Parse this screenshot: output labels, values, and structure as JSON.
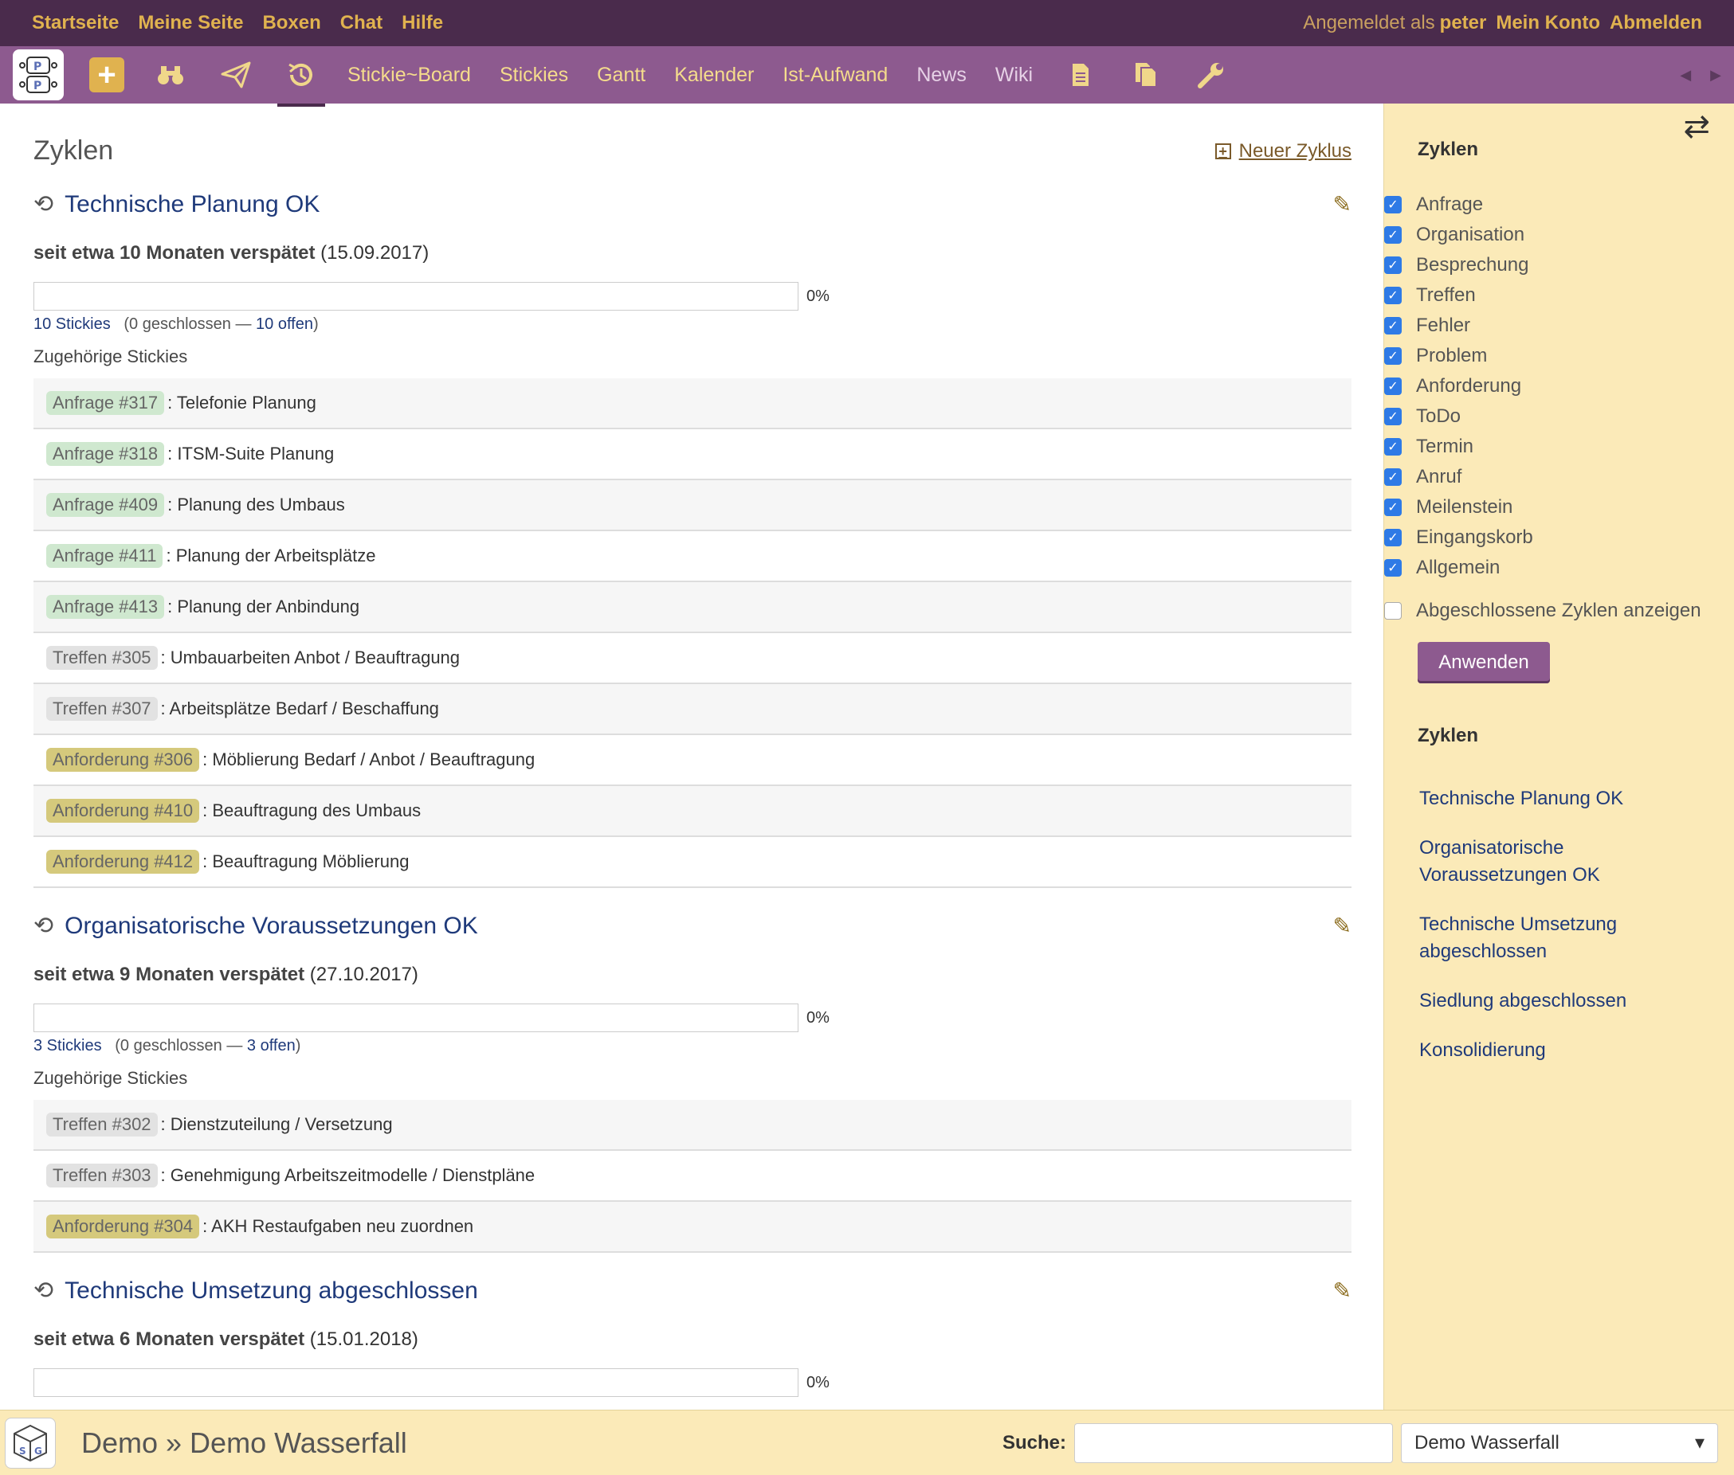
{
  "topbar": {
    "left": [
      "Startseite",
      "Meine Seite",
      "Boxen",
      "Chat",
      "Hilfe"
    ],
    "logged_in_as": "Angemeldet als",
    "user": "peter",
    "my_account": "Mein Konto",
    "logout": "Abmelden"
  },
  "nav": {
    "links": [
      "Stickie~Board",
      "Stickies",
      "Gantt",
      "Kalender",
      "Ist-Aufwand",
      "News",
      "Wiki"
    ]
  },
  "main": {
    "title": "Zyklen",
    "new_cycle": "Neuer Zyklus",
    "cycles": [
      {
        "title": "Technische Planung OK",
        "late": "seit etwa 10 Monaten verspätet",
        "date": "(15.09.2017)",
        "progress": 0,
        "progress_label": "0%",
        "stickies": "10 Stickies",
        "counts_open_paren": "(0 geschlossen —",
        "open": "10 offen",
        "close_paren": ")",
        "related": "Zugehörige Stickies",
        "issues": [
          {
            "tag": "Anfrage #317",
            "type": "anfrage",
            "text": ": Telefonie Planung"
          },
          {
            "tag": "Anfrage #318",
            "type": "anfrage",
            "text": ": ITSM-Suite Planung"
          },
          {
            "tag": "Anfrage #409",
            "type": "anfrage",
            "text": ": Planung des Umbaus"
          },
          {
            "tag": "Anfrage #411",
            "type": "anfrage",
            "text": ": Planung der Arbeitsplätze"
          },
          {
            "tag": "Anfrage #413",
            "type": "anfrage",
            "text": ": Planung der Anbindung"
          },
          {
            "tag": "Treffen #305",
            "type": "treffen",
            "text": ": Umbauarbeiten Anbot / Beauftragung"
          },
          {
            "tag": "Treffen #307",
            "type": "treffen",
            "text": ": Arbeitsplätze Bedarf / Beschaffung"
          },
          {
            "tag": "Anforderung #306",
            "type": "anforderung",
            "text": ": Möblierung Bedarf / Anbot / Beauftragung"
          },
          {
            "tag": "Anforderung #410",
            "type": "anforderung",
            "text": ": Beauftragung des Umbaus"
          },
          {
            "tag": "Anforderung #412",
            "type": "anforderung",
            "text": ": Beauftragung Möblierung"
          }
        ]
      },
      {
        "title": "Organisatorische Voraussetzungen OK",
        "late": "seit etwa 9 Monaten verspätet",
        "date": "(27.10.2017)",
        "progress": 0,
        "progress_label": "0%",
        "stickies": "3 Stickies",
        "counts_open_paren": "(0 geschlossen —",
        "open": "3 offen",
        "close_paren": ")",
        "related": "Zugehörige Stickies",
        "issues": [
          {
            "tag": "Treffen #302",
            "type": "treffen",
            "text": ": Dienstzuteilung / Versetzung"
          },
          {
            "tag": "Treffen #303",
            "type": "treffen",
            "text": ": Genehmigung Arbeitszeitmodelle / Dienstpläne"
          },
          {
            "tag": "Anforderung #304",
            "type": "anforderung",
            "text": ": AKH Restaufgaben neu zuordnen"
          }
        ]
      },
      {
        "title": "Technische Umsetzung abgeschlossen",
        "late": "seit etwa 6 Monaten verspätet",
        "date": "(15.01.2018)",
        "progress": 0,
        "progress_label": "0%",
        "issues": []
      }
    ]
  },
  "sidebar": {
    "filter_heading": "Zyklen",
    "filters": [
      "Anfrage",
      "Organisation",
      "Besprechung",
      "Treffen",
      "Fehler",
      "Problem",
      "Anforderung",
      "ToDo",
      "Termin",
      "Anruf",
      "Meilenstein",
      "Eingangskorb",
      "Allgemein"
    ],
    "show_closed": "Abgeschlossene Zyklen anzeigen",
    "apply": "Anwenden",
    "links_heading": "Zyklen",
    "links": [
      "Technische Planung OK",
      "Organisatorische Voraussetzungen OK",
      "Technische Umsetzung abgeschlossen",
      "Siedlung abgeschlossen",
      "Konsolidierung"
    ]
  },
  "footer": {
    "breadcrumb": "Demo » Demo Wasserfall",
    "search_label": "Suche:",
    "search_value": "",
    "project": "Demo Wasserfall"
  },
  "colors": {
    "topbar": "#4a2b4c",
    "navbar": "#8d5a8f",
    "accent": "#e0b24f",
    "sidebar": "#fbeab8",
    "link": "#1f3a7a"
  }
}
